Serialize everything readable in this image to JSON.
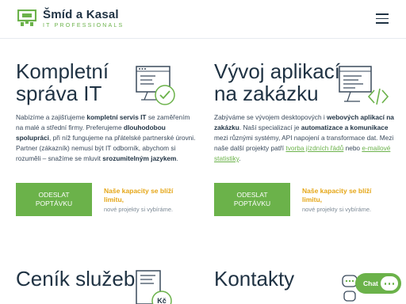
{
  "header": {
    "brand_name": "Šmíd a Kasal",
    "brand_sub": "IT PROFESSIONALS",
    "menu_icon": "hamburger-menu-icon",
    "logo_icon": "company-logo-icon"
  },
  "services": [
    {
      "title_line1": "Kompletní",
      "title_line2": "správa IT",
      "icon": "monitor-checkmark-icon",
      "desc_p1": "Nabízíme a zajišťujeme ",
      "desc_b1": "kompletní servis IT",
      "desc_p2": " se zaměřením na malé a střední firmy. Preferujeme ",
      "desc_b2": "dlouhodobou spolupráci",
      "desc_p3": ", při níž fungujeme na přátelské partnerské úrovni. Partner (zákazník) nemusí být IT odborník, abychom si rozuměli – snažíme se mluvit ",
      "desc_b3": "srozumitelným jazykem",
      "desc_p4": ".",
      "button_line1": "ODESLAT",
      "button_line2": "POPTÁVKU",
      "capacity_strong": "Naše kapacity se blíží limitu,",
      "capacity_sub": "nové projekty si vybíráme."
    },
    {
      "title_line1": "Vývoj aplikací",
      "title_line2": "na zakázku",
      "icon": "code-window-icon",
      "desc_p1": "Zabýváme se vývojem desktopových i ",
      "desc_b1": "webových aplikací na zakázku",
      "desc_p2": ". Naší specializací je ",
      "desc_b2": "automatizace a komunikace",
      "desc_p3": " mezi různými systémy, API napojení a transformace dat. Mezi naše další projekty patří ",
      "link1": "tvorba jízdních řádů",
      "desc_p4": " nebo ",
      "link2": "e-mailové statistiky",
      "desc_p5": ".",
      "button_line1": "ODESLAT",
      "button_line2": "POPTÁVKU",
      "capacity_strong": "Naše kapacity se blíží limitu,",
      "capacity_sub": "nové projekty si vybíráme."
    }
  ],
  "sections": {
    "pricing_title": "Ceník služeb",
    "pricing_icon": "price-list-kc-icon",
    "pricing_icon_text": "Kč",
    "contacts_title": "Kontakty",
    "contacts_icon": "chat-bubbles-icon"
  },
  "chat_widget": {
    "label": "Chat",
    "icon": "chat-bubble-icon"
  },
  "colors": {
    "accent_green": "#6bb24a",
    "heading_navy": "#1f3243",
    "capacity_orange": "#e5a617"
  }
}
